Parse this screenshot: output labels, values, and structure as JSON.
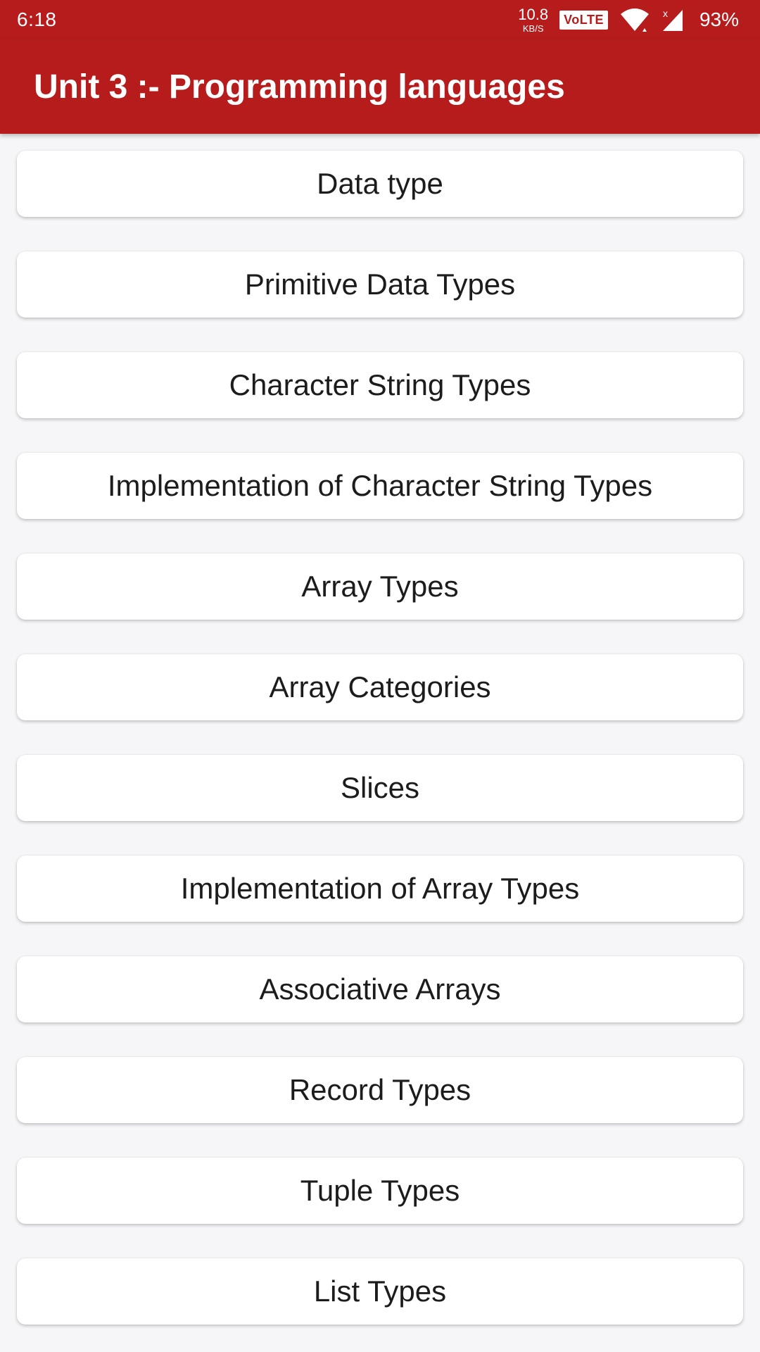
{
  "status_bar": {
    "time": "6:18",
    "net_speed_value": "10.8",
    "net_speed_unit": "KB/S",
    "volte_label": "VoLTE",
    "battery": "93%"
  },
  "app_bar": {
    "title": "Unit 3 :- Programming languages",
    "background_color": "#b71c1c"
  },
  "topics": [
    {
      "label": "Data type"
    },
    {
      "label": "Primitive Data Types"
    },
    {
      "label": "Character String Types"
    },
    {
      "label": "Implementation of Character String Types"
    },
    {
      "label": "Array Types"
    },
    {
      "label": "Array Categories"
    },
    {
      "label": "Slices"
    },
    {
      "label": "Implementation of Array Types"
    },
    {
      "label": "Associative Arrays"
    },
    {
      "label": "Record Types"
    },
    {
      "label": "Tuple Types"
    },
    {
      "label": "List Types"
    }
  ]
}
